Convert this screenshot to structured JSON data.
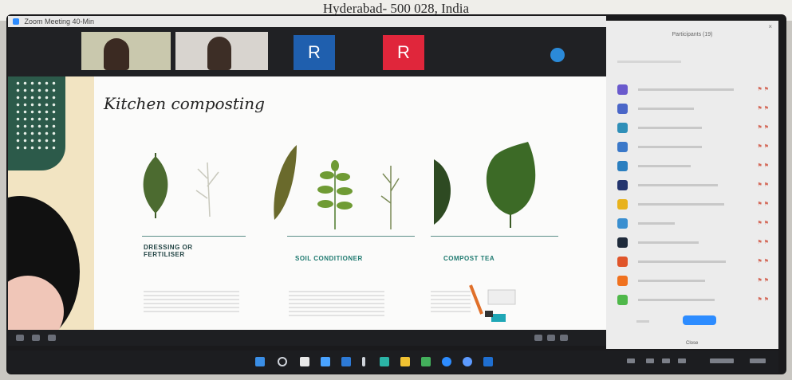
{
  "caption": "Hyderabad- 500 028, India",
  "window": {
    "title": "Zoom Meeting 40-Min"
  },
  "gallery": {
    "avatar_initial_1": "R",
    "avatar_initial_2": "R"
  },
  "slide": {
    "title": "Kitchen composting",
    "columns": [
      {
        "heading_line1": "DRESSING OR",
        "heading_line2": "FERTILISER"
      },
      {
        "heading": "SOIL CONDITIONER"
      },
      {
        "heading": "COMPOST TEA"
      }
    ]
  },
  "panel": {
    "title": "Participants (19)",
    "close_label": "Close"
  },
  "colors": {
    "zoom_blue": "#2d8cff",
    "avatar_red": "#e0263b",
    "avatar_blue": "#1f5fae",
    "slide_green": "#2c5a4a"
  },
  "icons": [
    "zoom-logo-icon",
    "microphone-icon",
    "video-icon",
    "windows-start-icon",
    "search-icon",
    "file-explorer-icon",
    "edge-icon",
    "chrome-icon",
    "wifi-icon",
    "volume-icon",
    "battery-icon"
  ]
}
